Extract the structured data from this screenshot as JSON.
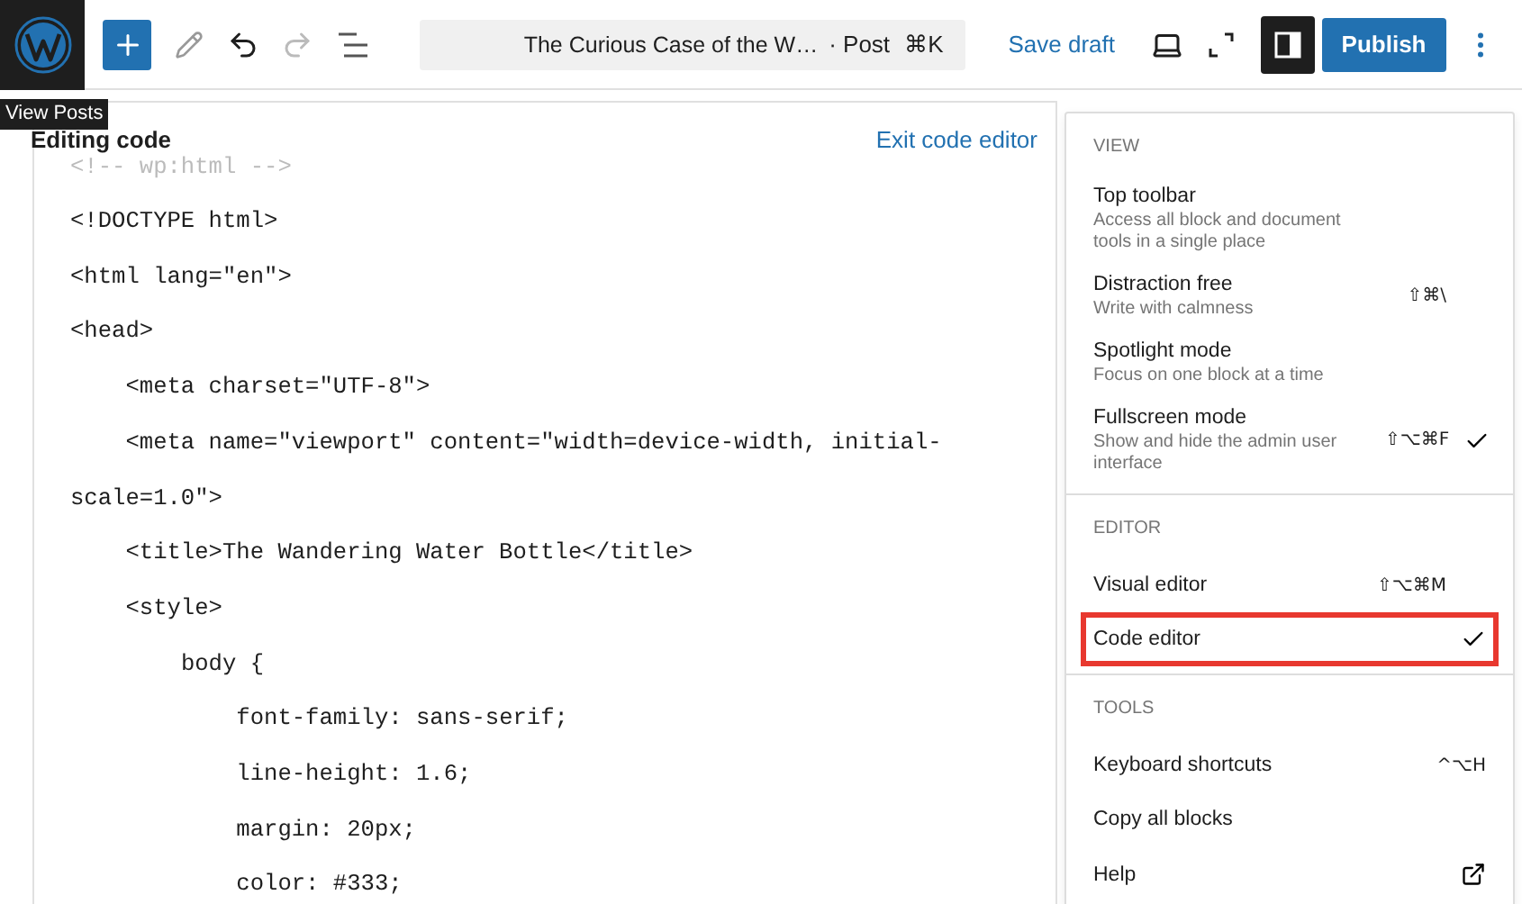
{
  "toolbar": {
    "tooltip": "View Posts",
    "undo_disabled": false,
    "redo_disabled": true,
    "command_bar": {
      "title": "The Curious Case of the W…",
      "post_type": "· Post",
      "shortcut": "⌘K"
    },
    "save_draft": "Save draft",
    "sidebar_pressed": true,
    "publish": "Publish"
  },
  "editor": {
    "heading": "Editing code",
    "exit": "Exit code editor",
    "comment": "<!-- wp:html -->",
    "lines": [
      "<!DOCTYPE html>",
      "<html lang=\"en\">",
      "<head>",
      "    <meta charset=\"UTF-8\">",
      "    <meta name=\"viewport\" content=\"width=device-width, initial-scale=1.0\">",
      "    <title>The Wandering Water Bottle</title>",
      "    <style>",
      "        body {",
      "            font-family: sans-serif;",
      "            line-height: 1.6;",
      "            margin: 20px;",
      "            color: #333;"
    ]
  },
  "menu": {
    "sections": [
      {
        "title": "VIEW",
        "items": [
          {
            "kind": "option",
            "label": "Top toolbar",
            "description": "Access all block and document tools in a single place",
            "checked": false,
            "highlighted": false
          },
          {
            "kind": "option",
            "label": "Distraction free",
            "description": "Write with calmness",
            "shortcut": "⇧⌘\\",
            "checked": false,
            "highlighted": false
          },
          {
            "kind": "option",
            "label": "Spotlight mode",
            "description": "Focus on one block at a time",
            "checked": false,
            "highlighted": false
          },
          {
            "kind": "option",
            "label": "Fullscreen mode",
            "description": "Show and hide the admin user interface",
            "shortcut": "⇧⌥⌘F",
            "checked": true,
            "highlighted": false
          }
        ]
      },
      {
        "title": "EDITOR",
        "items": [
          {
            "kind": "option",
            "label": "Visual editor",
            "shortcut": "⇧⌥⌘M",
            "checked": false,
            "highlighted": false
          },
          {
            "kind": "option",
            "label": "Code editor",
            "checked": true,
            "highlighted": true
          }
        ]
      },
      {
        "title": "TOOLS",
        "items": [
          {
            "kind": "action",
            "label": "Keyboard shortcuts",
            "shortcut": "^⌥H",
            "highlighted": false
          },
          {
            "kind": "action",
            "label": "Copy all blocks",
            "highlighted": false
          },
          {
            "kind": "link",
            "label": "Help",
            "highlighted": false
          }
        ]
      }
    ]
  }
}
